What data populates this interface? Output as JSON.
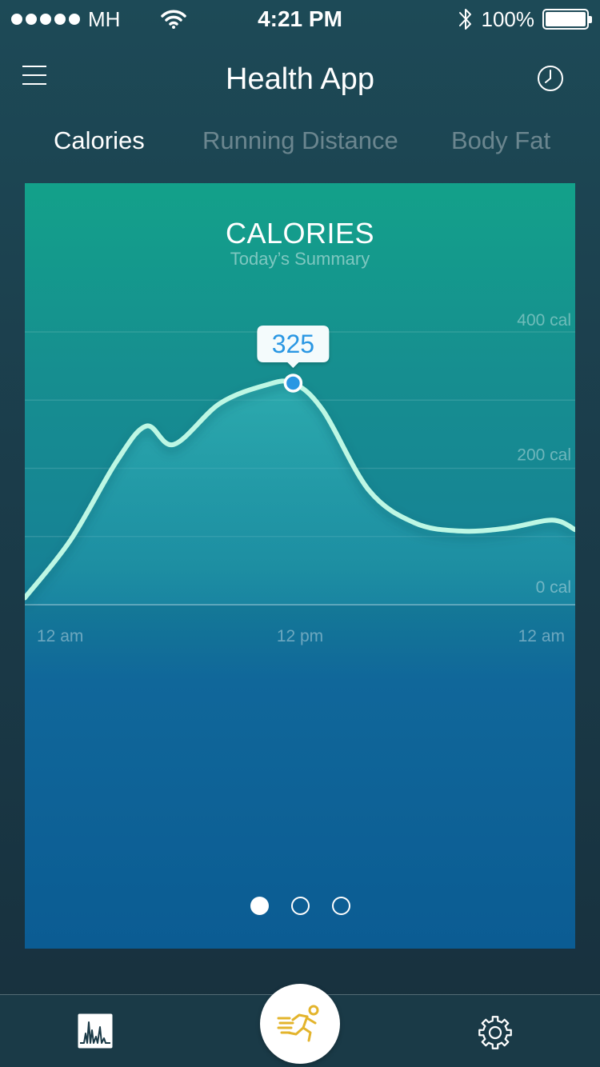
{
  "status_bar": {
    "carrier": "MH",
    "time": "4:21 PM",
    "battery_percent": "100%",
    "icons": [
      "signal-dots-icon",
      "wifi-icon",
      "bluetooth-icon",
      "battery-icon"
    ]
  },
  "header": {
    "title": "Health App",
    "left_icon": "menu-icon",
    "right_icon": "clock-icon"
  },
  "tabs": [
    {
      "label": "Calories",
      "active": true
    },
    {
      "label": "Running Distance",
      "active": false
    },
    {
      "label": "Body Fat",
      "active": false
    }
  ],
  "card": {
    "title": "CALORIES",
    "subtitle": "Today’s Summary",
    "pagination": {
      "count": 3,
      "active_index": 0
    }
  },
  "chart_data": {
    "type": "area",
    "title": "CALORIES",
    "subtitle": "Today’s Summary",
    "y_tick_labels": [
      "400 cal",
      "200 cal",
      "0 cal"
    ],
    "x_tick_labels": [
      "12 am",
      "12 pm",
      "12 am"
    ],
    "ylim": [
      0,
      400
    ],
    "xlim": [
      0,
      24
    ],
    "x": [
      0,
      2,
      4,
      5.3,
      6.5,
      8.5,
      10.5,
      11.7,
      13,
      15,
      17,
      19,
      21,
      23,
      24
    ],
    "values": [
      10,
      95,
      210,
      262,
      235,
      295,
      322,
      325,
      285,
      168,
      120,
      108,
      112,
      124,
      110
    ],
    "highlight": {
      "x": 11.7,
      "value": 325,
      "label": "325"
    },
    "grid": true,
    "colors": {
      "line": "#bdf7e4",
      "marker": "#2a97e3",
      "tooltip_text": "#2a97e3"
    }
  },
  "tab_bar": {
    "items": [
      {
        "name": "stats",
        "icon": "bar-chart-icon"
      },
      {
        "name": "run",
        "icon": "running-man-icon",
        "accent": "#e3b42c"
      },
      {
        "name": "settings",
        "icon": "gear-icon"
      }
    ]
  }
}
